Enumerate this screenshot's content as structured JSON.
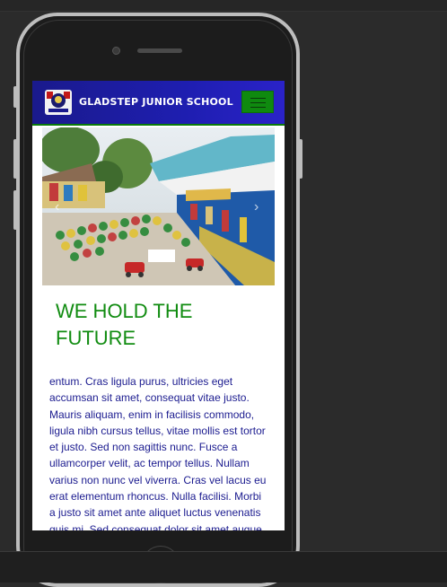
{
  "site": {
    "brand": "GLADSTEP JUNIOR SCHOOL",
    "colors": {
      "navbar": "#1e1eb0",
      "accent": "#0f8a0f",
      "headline": "#118c11",
      "body_text": "#1b1b8f"
    }
  },
  "nav": {
    "toggle_icon": "hamburger-menu-icon"
  },
  "hero": {
    "prev_icon": "chevron-left-icon",
    "next_icon": "chevron-right-icon",
    "prev_glyph": "‹",
    "next_glyph": "›"
  },
  "headline": "WE HOLD THE FUTURE",
  "body": "entum. Cras ligula purus, ultricies eget accumsan sit amet, consequat vitae justo. Mauris aliquam, enim in facilisis commodo, ligula nibh cursus tellus, vitae mollis est tortor et justo. Sed non sagittis nunc. Fusce a ullamcorper velit, ac tempor tellus. Nullam varius non nunc vel viverra. Cras vel lacus eu erat elementum rhoncus. Nulla facilisi. Morbi a justo sit amet ante aliquet luctus venenatis quis mi. Sed consequat dolor sit amet augue"
}
